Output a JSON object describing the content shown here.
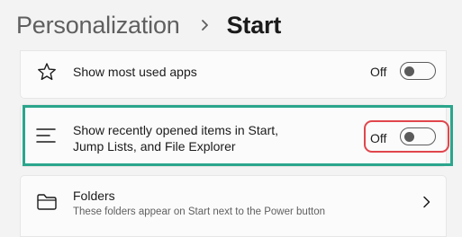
{
  "header": {
    "parent": "Personalization",
    "current": "Start"
  },
  "settings": [
    {
      "icon": "star-icon",
      "label": "Show most used apps",
      "state": "Off"
    },
    {
      "icon": "recent-list-icon",
      "label_line1": "Show recently opened items in Start,",
      "label_line2": "Jump Lists, and File Explorer",
      "state": "Off"
    },
    {
      "icon": "folder-icon",
      "label": "Folders",
      "description": "These folders appear on Start next to the Power button"
    }
  ],
  "colors": {
    "highlight": "#2ba58c",
    "callout": "#e0464c"
  }
}
